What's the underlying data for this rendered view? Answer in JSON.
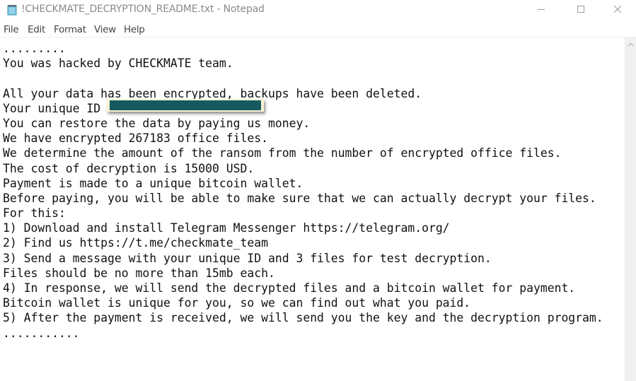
{
  "window": {
    "title": "!CHECKMATE_DECRYPTION_README.txt - Notepad",
    "app_icon": "notepad-icon",
    "controls": [
      "minimize-icon",
      "maximize-icon",
      "close-icon"
    ]
  },
  "menu": {
    "items": [
      {
        "label": "File"
      },
      {
        "label": "Edit"
      },
      {
        "label": "Format"
      },
      {
        "label": "View"
      },
      {
        "label": "Help"
      }
    ]
  },
  "document": {
    "lines": [
      ".........",
      "You was hacked by CHECKMATE team.",
      "",
      "All your data has been encrypted, backups have been deleted.",
      "Your unique ID",
      "You can restore the data by paying us money.",
      "We have encrypted 267183 office files.",
      "We determine the amount of the ransom from the number of encrypted office files.",
      "The cost of decryption is 15000 USD.",
      "Payment is made to a unique bitcoin wallet.",
      "Before paying, you will be able to make sure that we can actually decrypt your files.",
      "For this:",
      "1) Download and install Telegram Messenger https://telegram.org/",
      "2) Find us https://t.me/checkmate_team",
      "3) Send a message with your unique ID and 3 files for test decryption.",
      "Files should be no more than 15mb each.",
      "4) In response, we will send the decrypted files and a bitcoin wallet for payment.",
      "Bitcoin wallet is unique for you, so we can find out what you paid.",
      "5) After the payment is received, we will send you the key and the decryption program.",
      "..........."
    ],
    "redaction": {
      "label": "redacted unique ID",
      "color": "#145a5e",
      "border_color": "#fbf3d5"
    }
  },
  "scrollbar": {
    "up_arrow": "chevron-up-icon"
  }
}
